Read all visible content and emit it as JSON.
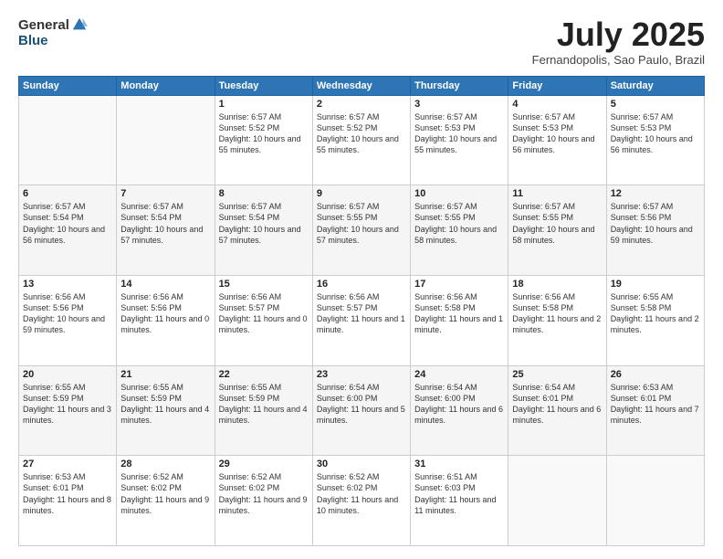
{
  "header": {
    "logo_general": "General",
    "logo_blue": "Blue",
    "month_title": "July 2025",
    "subtitle": "Fernandopolis, Sao Paulo, Brazil"
  },
  "days_of_week": [
    "Sunday",
    "Monday",
    "Tuesday",
    "Wednesday",
    "Thursday",
    "Friday",
    "Saturday"
  ],
  "rows": [
    [
      {
        "day": "",
        "text": ""
      },
      {
        "day": "",
        "text": ""
      },
      {
        "day": "1",
        "text": "Sunrise: 6:57 AM\nSunset: 5:52 PM\nDaylight: 10 hours\nand 55 minutes."
      },
      {
        "day": "2",
        "text": "Sunrise: 6:57 AM\nSunset: 5:52 PM\nDaylight: 10 hours\nand 55 minutes."
      },
      {
        "day": "3",
        "text": "Sunrise: 6:57 AM\nSunset: 5:53 PM\nDaylight: 10 hours\nand 55 minutes."
      },
      {
        "day": "4",
        "text": "Sunrise: 6:57 AM\nSunset: 5:53 PM\nDaylight: 10 hours\nand 56 minutes."
      },
      {
        "day": "5",
        "text": "Sunrise: 6:57 AM\nSunset: 5:53 PM\nDaylight: 10 hours\nand 56 minutes."
      }
    ],
    [
      {
        "day": "6",
        "text": "Sunrise: 6:57 AM\nSunset: 5:54 PM\nDaylight: 10 hours\nand 56 minutes."
      },
      {
        "day": "7",
        "text": "Sunrise: 6:57 AM\nSunset: 5:54 PM\nDaylight: 10 hours\nand 57 minutes."
      },
      {
        "day": "8",
        "text": "Sunrise: 6:57 AM\nSunset: 5:54 PM\nDaylight: 10 hours\nand 57 minutes."
      },
      {
        "day": "9",
        "text": "Sunrise: 6:57 AM\nSunset: 5:55 PM\nDaylight: 10 hours\nand 57 minutes."
      },
      {
        "day": "10",
        "text": "Sunrise: 6:57 AM\nSunset: 5:55 PM\nDaylight: 10 hours\nand 58 minutes."
      },
      {
        "day": "11",
        "text": "Sunrise: 6:57 AM\nSunset: 5:55 PM\nDaylight: 10 hours\nand 58 minutes."
      },
      {
        "day": "12",
        "text": "Sunrise: 6:57 AM\nSunset: 5:56 PM\nDaylight: 10 hours\nand 59 minutes."
      }
    ],
    [
      {
        "day": "13",
        "text": "Sunrise: 6:56 AM\nSunset: 5:56 PM\nDaylight: 10 hours\nand 59 minutes."
      },
      {
        "day": "14",
        "text": "Sunrise: 6:56 AM\nSunset: 5:56 PM\nDaylight: 11 hours\nand 0 minutes."
      },
      {
        "day": "15",
        "text": "Sunrise: 6:56 AM\nSunset: 5:57 PM\nDaylight: 11 hours\nand 0 minutes."
      },
      {
        "day": "16",
        "text": "Sunrise: 6:56 AM\nSunset: 5:57 PM\nDaylight: 11 hours\nand 1 minute."
      },
      {
        "day": "17",
        "text": "Sunrise: 6:56 AM\nSunset: 5:58 PM\nDaylight: 11 hours\nand 1 minute."
      },
      {
        "day": "18",
        "text": "Sunrise: 6:56 AM\nSunset: 5:58 PM\nDaylight: 11 hours\nand 2 minutes."
      },
      {
        "day": "19",
        "text": "Sunrise: 6:55 AM\nSunset: 5:58 PM\nDaylight: 11 hours\nand 2 minutes."
      }
    ],
    [
      {
        "day": "20",
        "text": "Sunrise: 6:55 AM\nSunset: 5:59 PM\nDaylight: 11 hours\nand 3 minutes."
      },
      {
        "day": "21",
        "text": "Sunrise: 6:55 AM\nSunset: 5:59 PM\nDaylight: 11 hours\nand 4 minutes."
      },
      {
        "day": "22",
        "text": "Sunrise: 6:55 AM\nSunset: 5:59 PM\nDaylight: 11 hours\nand 4 minutes."
      },
      {
        "day": "23",
        "text": "Sunrise: 6:54 AM\nSunset: 6:00 PM\nDaylight: 11 hours\nand 5 minutes."
      },
      {
        "day": "24",
        "text": "Sunrise: 6:54 AM\nSunset: 6:00 PM\nDaylight: 11 hours\nand 6 minutes."
      },
      {
        "day": "25",
        "text": "Sunrise: 6:54 AM\nSunset: 6:01 PM\nDaylight: 11 hours\nand 6 minutes."
      },
      {
        "day": "26",
        "text": "Sunrise: 6:53 AM\nSunset: 6:01 PM\nDaylight: 11 hours\nand 7 minutes."
      }
    ],
    [
      {
        "day": "27",
        "text": "Sunrise: 6:53 AM\nSunset: 6:01 PM\nDaylight: 11 hours\nand 8 minutes."
      },
      {
        "day": "28",
        "text": "Sunrise: 6:52 AM\nSunset: 6:02 PM\nDaylight: 11 hours\nand 9 minutes."
      },
      {
        "day": "29",
        "text": "Sunrise: 6:52 AM\nSunset: 6:02 PM\nDaylight: 11 hours\nand 9 minutes."
      },
      {
        "day": "30",
        "text": "Sunrise: 6:52 AM\nSunset: 6:02 PM\nDaylight: 11 hours\nand 10 minutes."
      },
      {
        "day": "31",
        "text": "Sunrise: 6:51 AM\nSunset: 6:03 PM\nDaylight: 11 hours\nand 11 minutes."
      },
      {
        "day": "",
        "text": ""
      },
      {
        "day": "",
        "text": ""
      }
    ]
  ]
}
